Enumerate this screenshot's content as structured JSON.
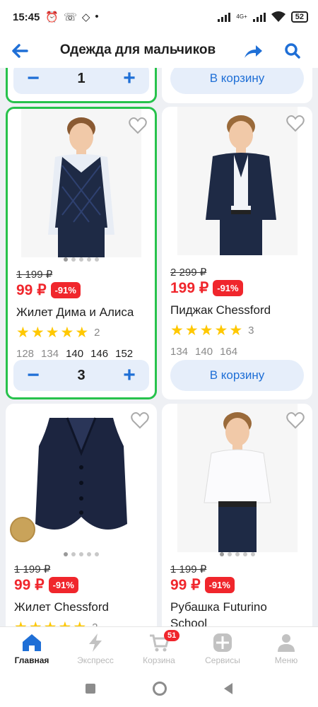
{
  "status": {
    "time": "15:45",
    "net": "4G+",
    "battery": "52"
  },
  "header": {
    "title": "Одежда для мальчиков",
    "back_icon": "back-arrow-icon",
    "share_icon": "share-icon",
    "search_icon": "search-icon"
  },
  "colors": {
    "accent": "#1f6fd6",
    "price": "#f0262c",
    "selected_border": "#27c24c",
    "star": "#ffc800"
  },
  "top_partial": {
    "left_qty": "1",
    "right_button": "В корзину"
  },
  "products": [
    {
      "old_price": "1 199 ₽",
      "price": "99 ₽",
      "discount": "-91%",
      "name": "Жилет Дима и Алиса",
      "rating_count": "2",
      "sizes": [
        {
          "v": "128",
          "a": false
        },
        {
          "v": "134",
          "a": false
        },
        {
          "v": "140",
          "a": true
        },
        {
          "v": "146",
          "a": true
        },
        {
          "v": "152",
          "a": true
        }
      ],
      "qty": "3",
      "selected": true
    },
    {
      "old_price": "2 299 ₽",
      "price": "199 ₽",
      "discount": "-91%",
      "name": "Пиджак Chessford",
      "rating_count": "3",
      "sizes": [
        {
          "v": "134",
          "a": false
        },
        {
          "v": "140",
          "a": false
        },
        {
          "v": "164",
          "a": false
        }
      ],
      "button": "В корзину",
      "selected": false
    },
    {
      "old_price": "1 199 ₽",
      "price": "99 ₽",
      "discount": "-91%",
      "name": "Жилет Chessford",
      "rating_count": "2",
      "selected": false
    },
    {
      "old_price": "1 199 ₽",
      "price": "99 ₽",
      "discount": "-91%",
      "name": "Рубашка Futurino School",
      "selected": false
    }
  ],
  "bottom_nav": [
    {
      "label": "Главная",
      "icon": "home-icon",
      "active": true
    },
    {
      "label": "Экспресс",
      "icon": "lightning-icon",
      "active": false
    },
    {
      "label": "Корзина",
      "icon": "cart-icon",
      "active": false,
      "badge": "51"
    },
    {
      "label": "Сервисы",
      "icon": "services-icon",
      "active": false
    },
    {
      "label": "Меню",
      "icon": "profile-icon",
      "active": false
    }
  ]
}
